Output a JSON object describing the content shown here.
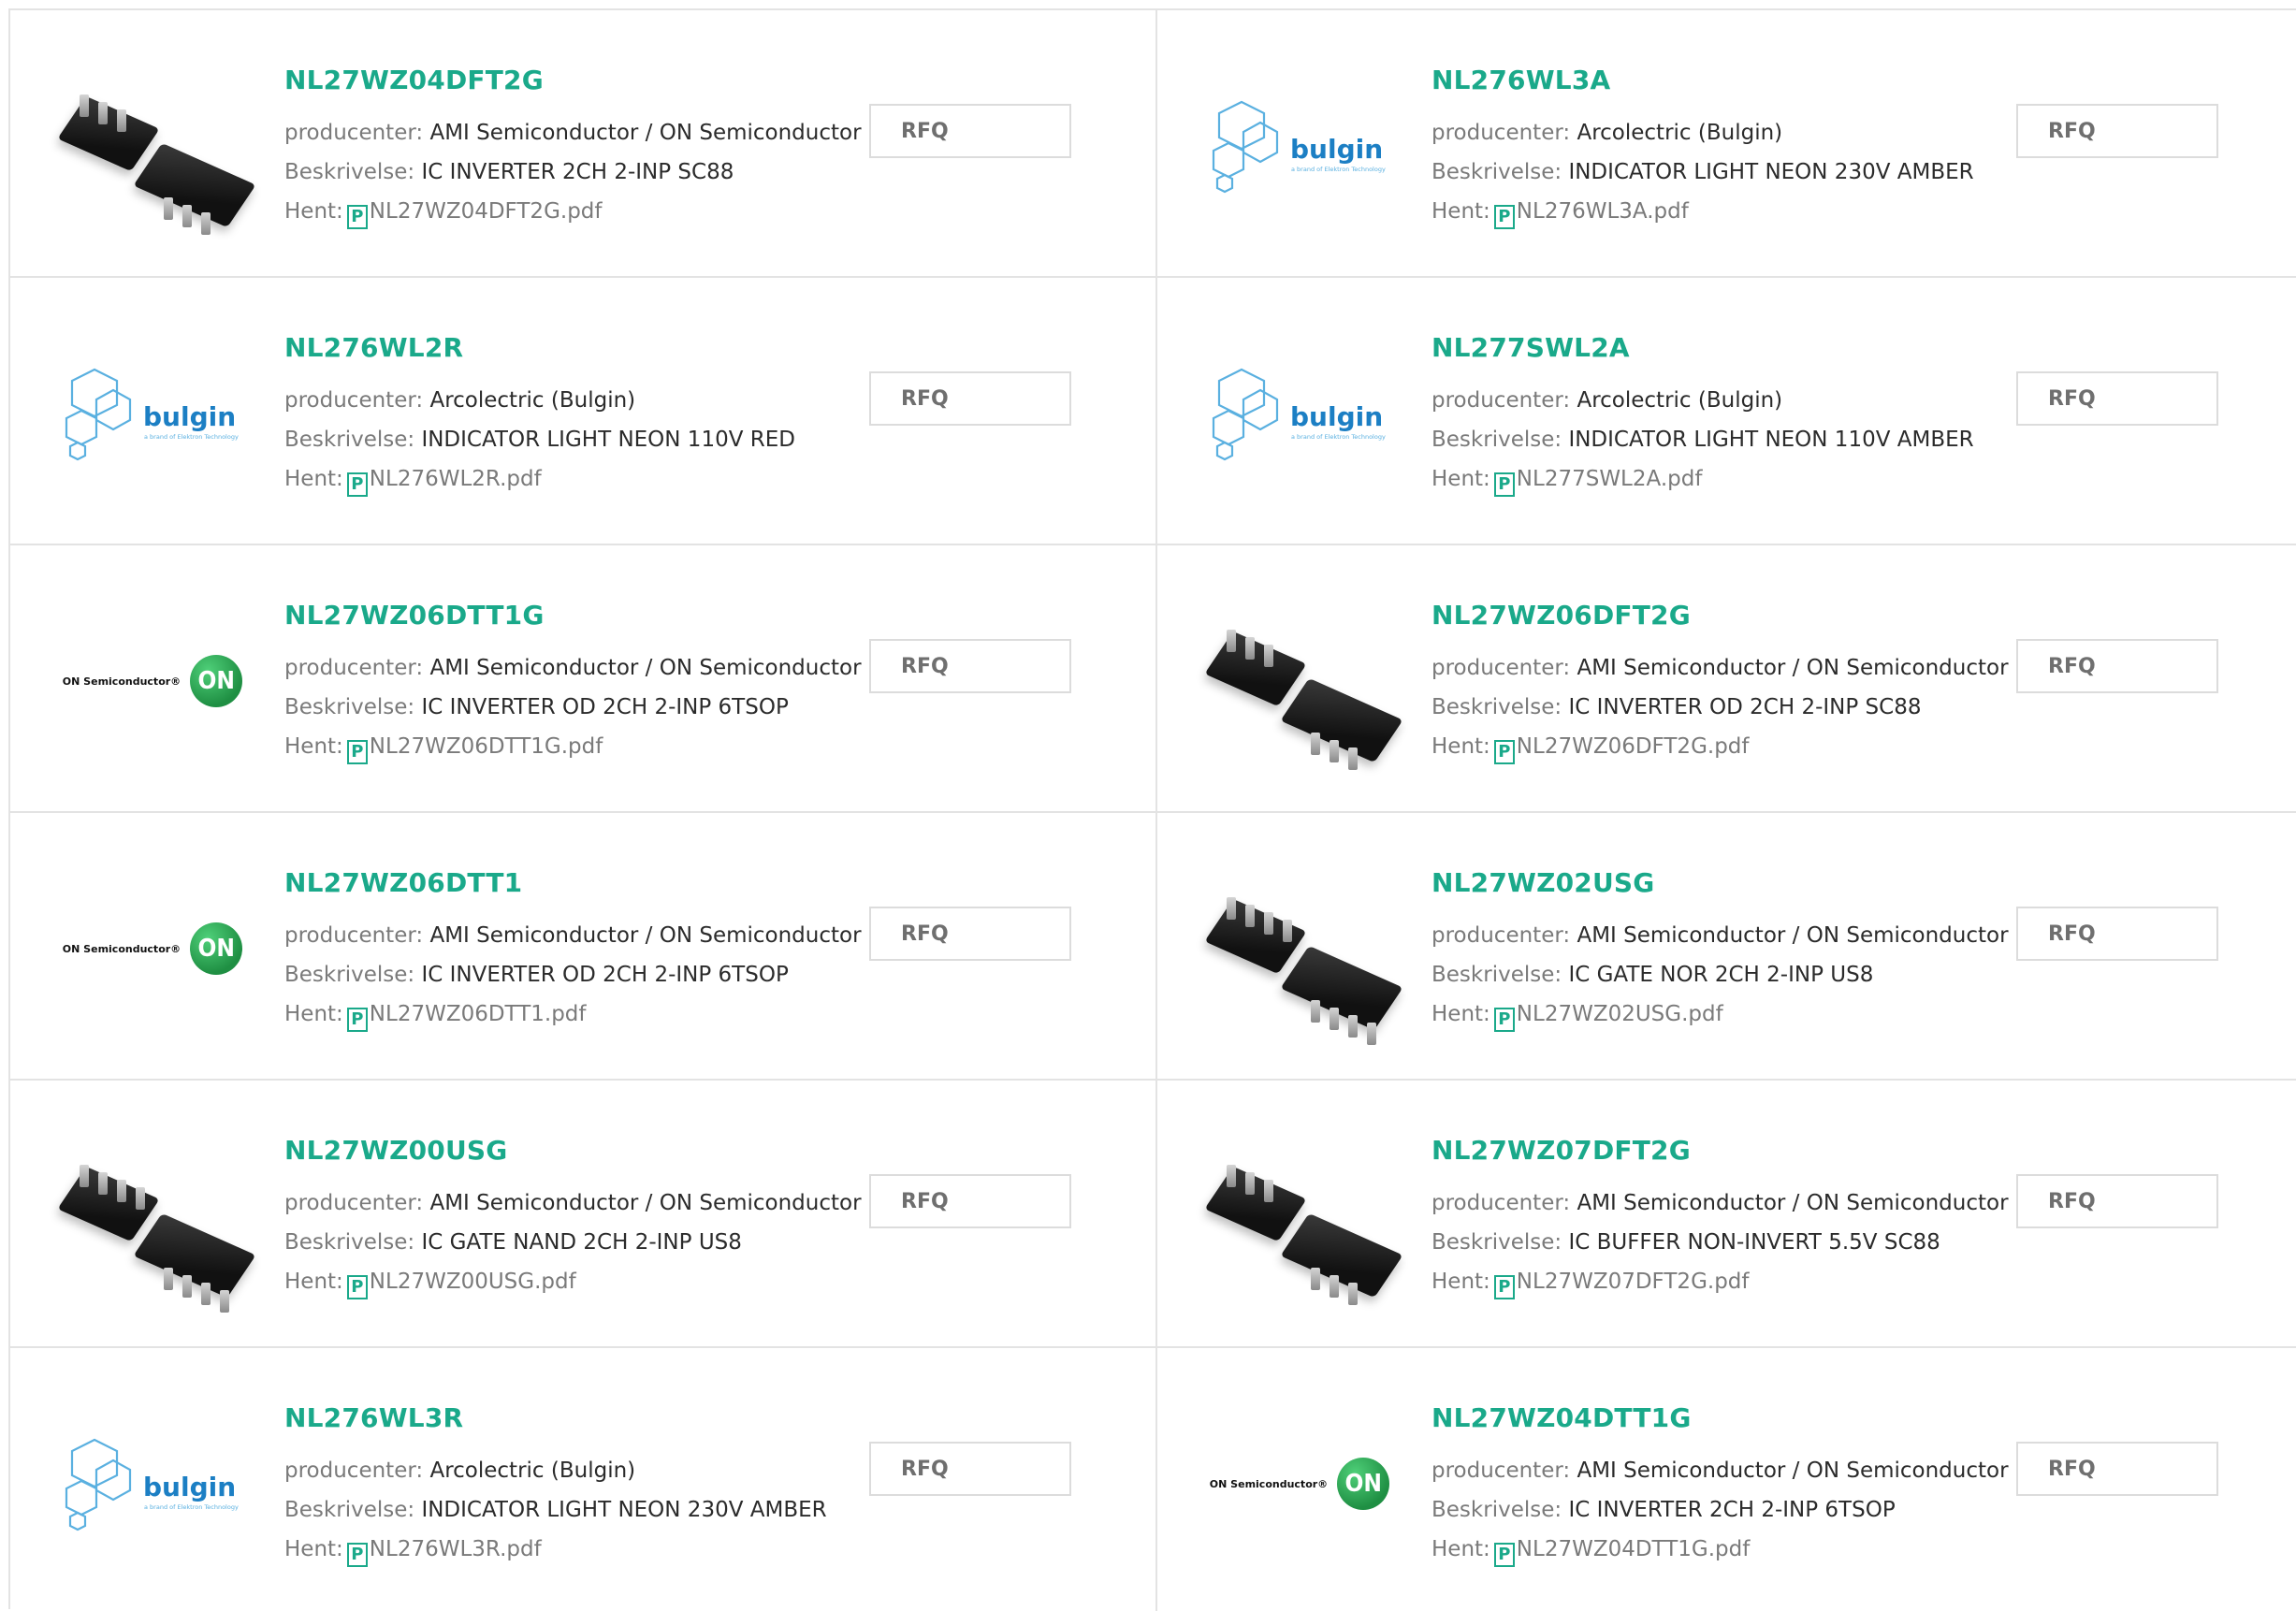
{
  "labels": {
    "manufacturer": "producenter:",
    "description": "Beskrivelse:",
    "download": "Hent:",
    "rfq": "RFQ",
    "pdf_glyph": "P"
  },
  "colors": {
    "part_number": "#1aa98a",
    "border": "#e3e3e3",
    "label": "#7a7a7a",
    "value": "#2b2b2b"
  },
  "products": [
    {
      "part": "NL27WZ04DFT2G",
      "manufacturer": "AMI Semiconductor / ON Semiconductor",
      "description": "IC INVERTER 2CH 2-INP SC88",
      "file": "NL27WZ04DFT2G.pdf",
      "image": "sc88-chip"
    },
    {
      "part": "NL276WL3A",
      "manufacturer": "Arcolectric (Bulgin)",
      "description": "INDICATOR LIGHT NEON 230V AMBER",
      "file": "NL276WL3A.pdf",
      "image": "bulgin-logo"
    },
    {
      "part": "NL276WL2R",
      "manufacturer": "Arcolectric (Bulgin)",
      "description": "INDICATOR LIGHT NEON 110V RED",
      "file": "NL276WL2R.pdf",
      "image": "bulgin-logo"
    },
    {
      "part": "NL277SWL2A",
      "manufacturer": "Arcolectric (Bulgin)",
      "description": "INDICATOR LIGHT NEON 110V AMBER",
      "file": "NL277SWL2A.pdf",
      "image": "bulgin-logo"
    },
    {
      "part": "NL27WZ06DTT1G",
      "manufacturer": "AMI Semiconductor / ON Semiconductor",
      "description": "IC INVERTER OD 2CH 2-INP 6TSOP",
      "file": "NL27WZ06DTT1G.pdf",
      "image": "on-logo"
    },
    {
      "part": "NL27WZ06DFT2G",
      "manufacturer": "AMI Semiconductor / ON Semiconductor",
      "description": "IC INVERTER OD 2CH 2-INP SC88",
      "file": "NL27WZ06DFT2G.pdf",
      "image": "sc88-chip"
    },
    {
      "part": "NL27WZ06DTT1",
      "manufacturer": "AMI Semiconductor / ON Semiconductor",
      "description": "IC INVERTER OD 2CH 2-INP 6TSOP",
      "file": "NL27WZ06DTT1.pdf",
      "image": "on-logo"
    },
    {
      "part": "NL27WZ02USG",
      "manufacturer": "AMI Semiconductor / ON Semiconductor",
      "description": "IC GATE NOR 2CH 2-INP US8",
      "file": "NL27WZ02USG.pdf",
      "image": "us8-chip"
    },
    {
      "part": "NL27WZ00USG",
      "manufacturer": "AMI Semiconductor / ON Semiconductor",
      "description": "IC GATE NAND 2CH 2-INP US8",
      "file": "NL27WZ00USG.pdf",
      "image": "us8-chip"
    },
    {
      "part": "NL27WZ07DFT2G",
      "manufacturer": "AMI Semiconductor / ON Semiconductor",
      "description": "IC BUFFER NON-INVERT 5.5V SC88",
      "file": "NL27WZ07DFT2G.pdf",
      "image": "sc88-chip"
    },
    {
      "part": "NL276WL3R",
      "manufacturer": "Arcolectric (Bulgin)",
      "description": "INDICATOR LIGHT NEON 230V AMBER",
      "file": "NL276WL3R.pdf",
      "image": "bulgin-logo"
    },
    {
      "part": "NL27WZ04DTT1G",
      "manufacturer": "AMI Semiconductor / ON Semiconductor",
      "description": "IC INVERTER 2CH 2-INP 6TSOP",
      "file": "NL27WZ04DTT1G.pdf",
      "image": "on-logo"
    }
  ],
  "logos": {
    "bulgin": "bulgin",
    "bulgin_tagline": "a brand of Elektron Technology",
    "on_text": "ON Semiconductor®",
    "on_mark": "ON"
  }
}
